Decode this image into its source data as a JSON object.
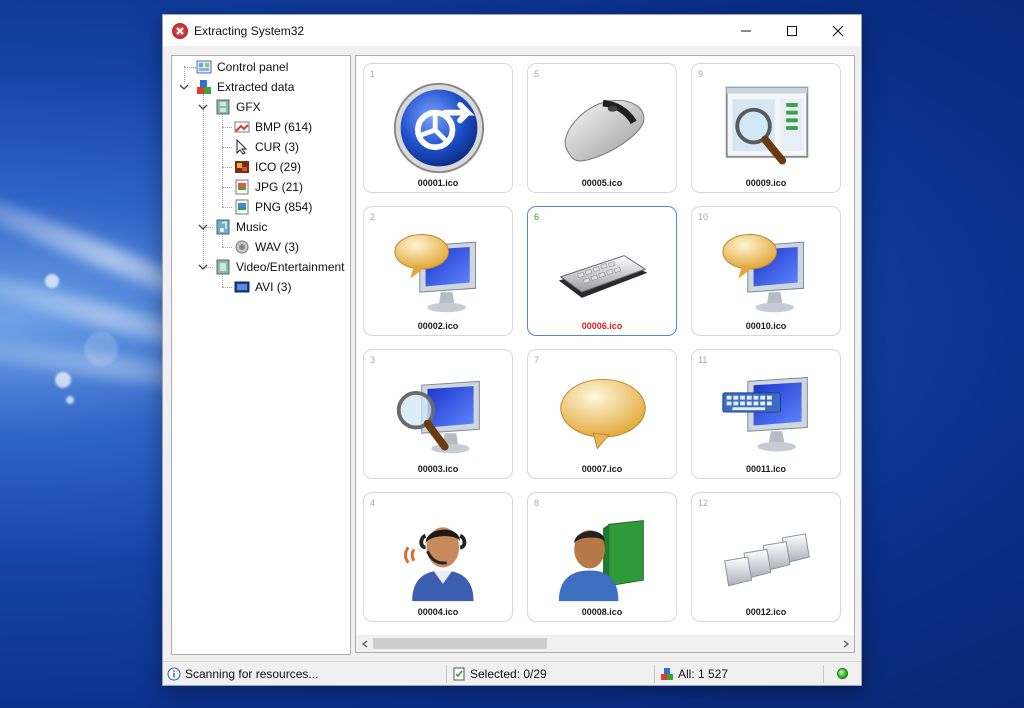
{
  "window": {
    "title": "Extracting System32",
    "controls": {
      "minimize": "minimize-icon",
      "maximize": "maximize-icon",
      "close": "close-icon"
    }
  },
  "tree": {
    "control_panel": "Control panel",
    "extracted": "Extracted data",
    "gfx": "GFX",
    "bmp": "BMP (614)",
    "cur": "CUR (3)",
    "ico": "ICO (29)",
    "jpg": "JPG (21)",
    "png": "PNG (854)",
    "music": "Music",
    "wav": "WAV (3)",
    "video": "Video/Entertainment",
    "avi": "AVI (3)"
  },
  "grid": {
    "items": [
      {
        "num": "1",
        "file": "00001.ico",
        "icon": "media-sync-icon"
      },
      {
        "num": "5",
        "file": "00005.ico",
        "icon": "mouse-icon"
      },
      {
        "num": "9",
        "file": "00009.ico",
        "icon": "document-search-icon"
      },
      {
        "num": "2",
        "file": "00002.ico",
        "icon": "monitor-speech-icon"
      },
      {
        "num": "6",
        "file": "00006.ico",
        "icon": "keyboard-icon",
        "selected": true
      },
      {
        "num": "10",
        "file": "00010.ico",
        "icon": "monitor-speech-icon"
      },
      {
        "num": "3",
        "file": "00003.ico",
        "icon": "monitor-magnifier-icon"
      },
      {
        "num": "7",
        "file": "00007.ico",
        "icon": "speech-bubble-icon"
      },
      {
        "num": "11",
        "file": "00011.ico",
        "icon": "monitor-keyboard-icon"
      },
      {
        "num": "4",
        "file": "00004.ico",
        "icon": "user-headset-icon"
      },
      {
        "num": "8",
        "file": "00008.ico",
        "icon": "user-book-icon"
      },
      {
        "num": "12",
        "file": "00012.ico",
        "icon": "keys-icon"
      }
    ]
  },
  "status": {
    "scan": "Scanning for resources...",
    "selected": "Selected: 0/29",
    "all": "All: 1 527"
  },
  "colors": {
    "selected_border": "#5b86c6",
    "selected_name": "#d92020",
    "selected_num": "#2c9b2c",
    "status_led": "#2fbf24"
  }
}
